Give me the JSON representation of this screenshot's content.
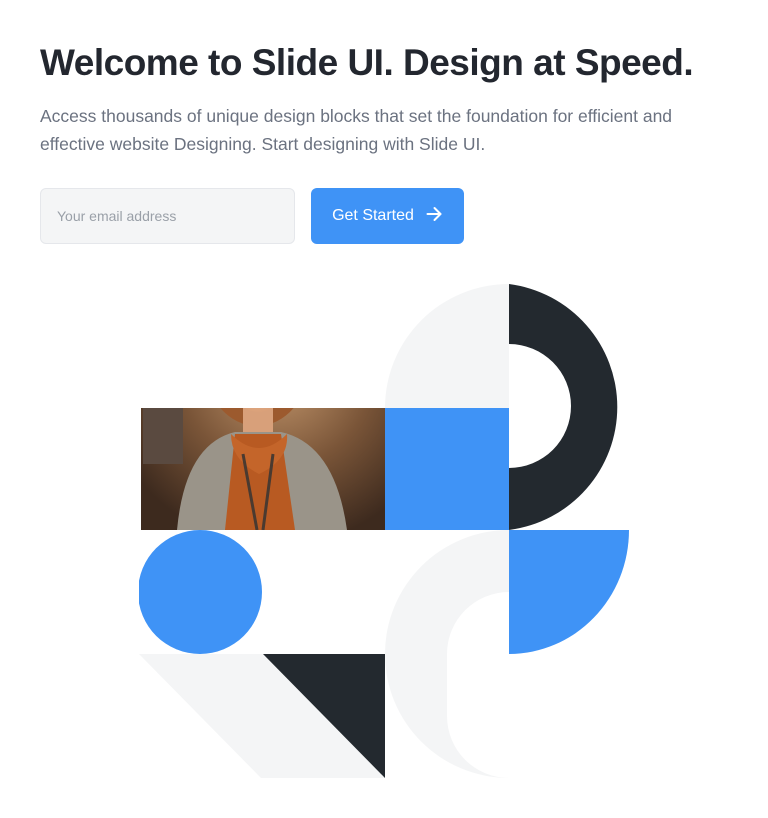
{
  "hero": {
    "title": "Welcome to Slide UI. Design at Speed.",
    "subtitle": "Access thousands of unique design blocks that set the foundation for efficient and effective website Designing. Start designing with Slide UI."
  },
  "signup": {
    "email_placeholder": "Your email address",
    "email_value": "",
    "cta_label": "Get Started",
    "cta_icon": "arrow-right-icon"
  },
  "illustration": {
    "photo_description_icon": "avatar-photo",
    "colors": {
      "blue": "#3f93f6",
      "dark": "#23292f",
      "light_gray": "#f4f5f6",
      "photo_bg": "#8a6446",
      "sweater": "#b85a22"
    }
  }
}
